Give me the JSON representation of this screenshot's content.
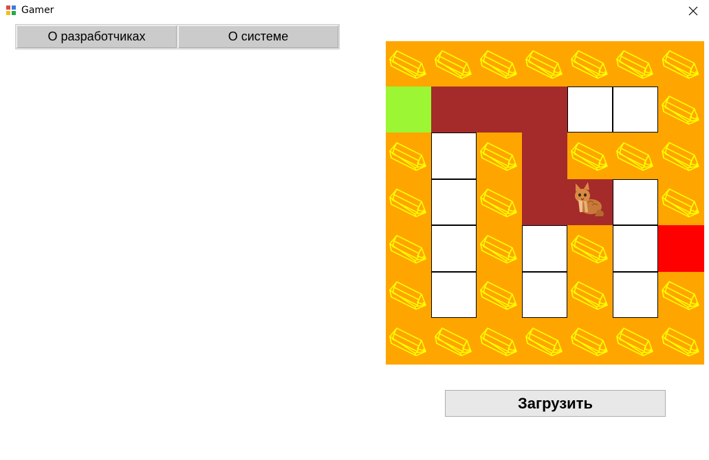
{
  "window": {
    "title": "Gamer"
  },
  "menu": {
    "developers_label": "О разработчиках",
    "system_label": "О системе"
  },
  "board": {
    "rows": 7,
    "cols": 7,
    "grid": [
      [
        "W",
        "W",
        "W",
        "W",
        "W",
        "W",
        "W"
      ],
      [
        "G",
        "B",
        "B",
        "B",
        "E",
        "E",
        "W"
      ],
      [
        "W",
        "E",
        "W",
        "B",
        "W",
        "W",
        "W"
      ],
      [
        "W",
        "E",
        "W",
        "B",
        "P",
        "E",
        "W"
      ],
      [
        "W",
        "E",
        "W",
        "E",
        "W",
        "E",
        "R"
      ],
      [
        "W",
        "E",
        "W",
        "E",
        "W",
        "E",
        "W"
      ],
      [
        "W",
        "W",
        "W",
        "W",
        "W",
        "W",
        "W"
      ]
    ],
    "legend": {
      "W": "wall-pencil-tile",
      "E": "empty-path",
      "B": "visited-path",
      "G": "start",
      "R": "finish",
      "P": "player-cat"
    },
    "colors": {
      "wall": "#ffa500",
      "pencil": "#ffff00",
      "empty": "#ffffff",
      "visited": "#a52a2a",
      "start": "#9cf633",
      "finish": "#ff0000"
    },
    "player_icon": "cat-icon",
    "wall_icon": "pencil-icon"
  },
  "actions": {
    "load_label": "Загрузить"
  }
}
